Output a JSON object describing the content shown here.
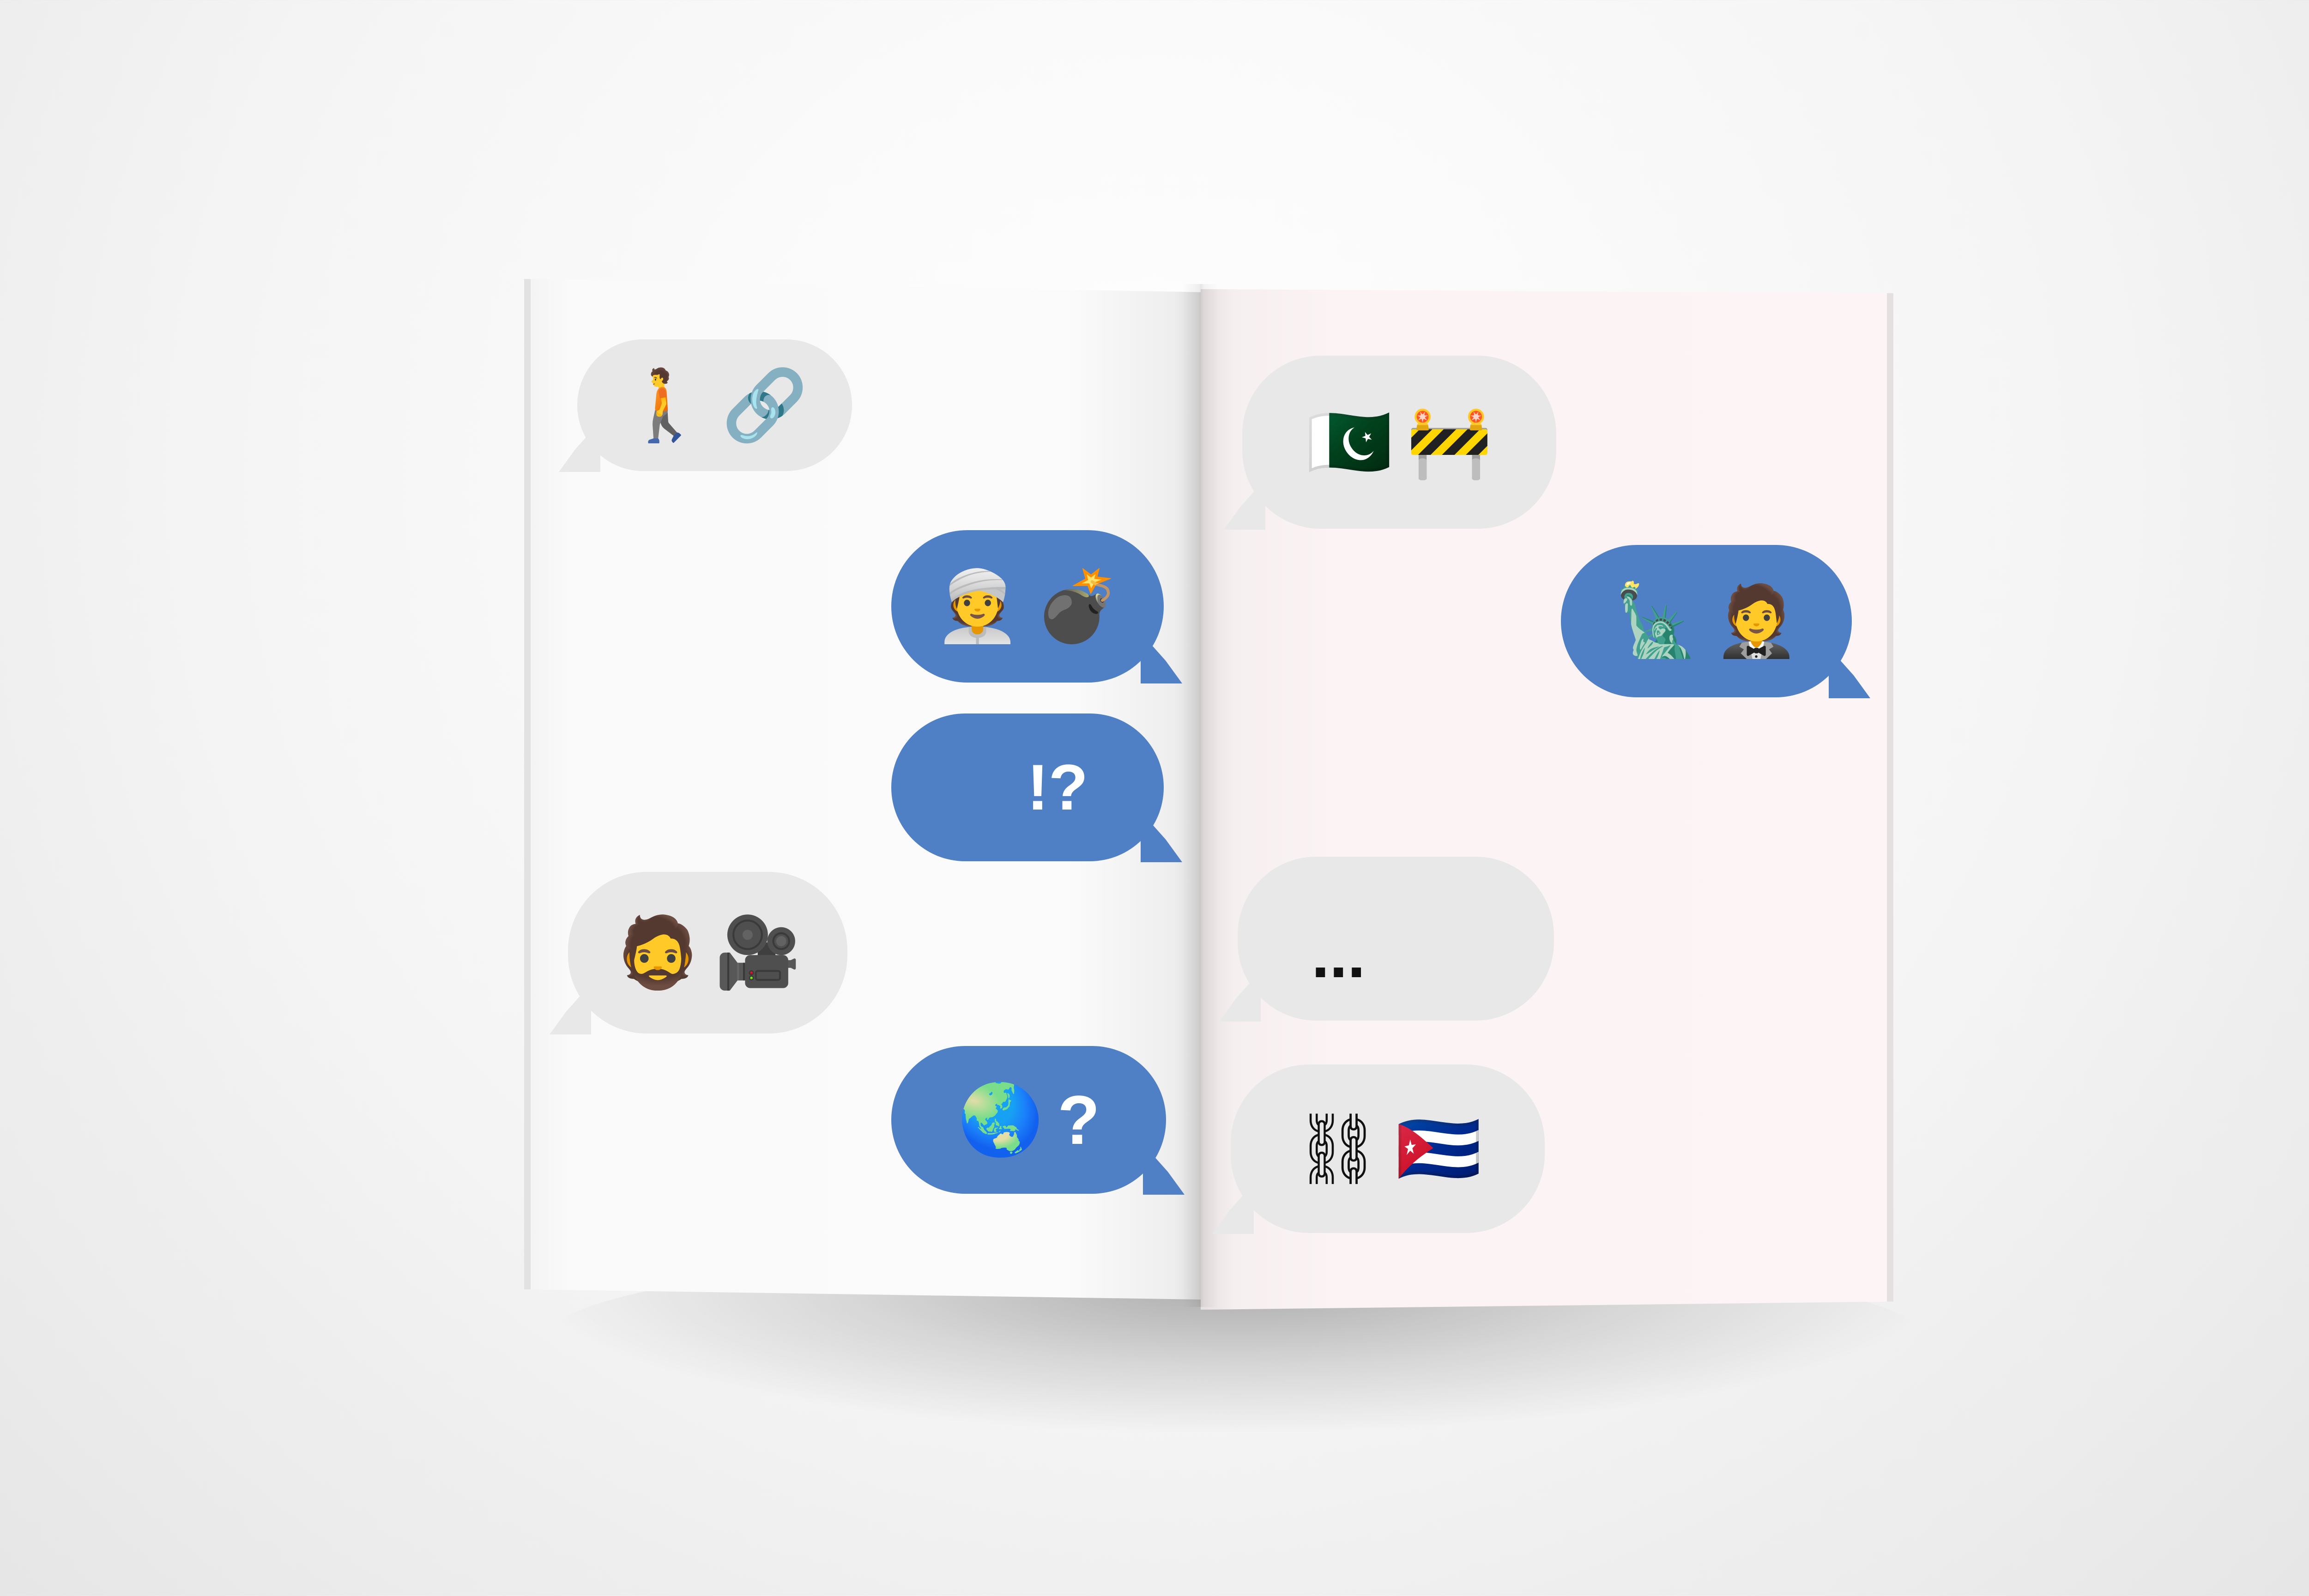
{
  "colors": {
    "incoming_bubble": "#e8e8e8",
    "outgoing_bubble": "#4f7fc4",
    "left_page": "#fbfbfb",
    "right_page": "#fdf5f5"
  },
  "left_page": {
    "messages": [
      {
        "side": "incoming",
        "parts": [
          "🚶",
          "🔗"
        ],
        "icons": [
          "person-walking-icon",
          "link-icon"
        ]
      },
      {
        "side": "outgoing",
        "parts": [
          "👳",
          "💣"
        ],
        "icons": [
          "man-with-turban-icon",
          "bomb-icon"
        ]
      },
      {
        "side": "outgoing",
        "parts": [
          "!?"
        ],
        "icons": []
      },
      {
        "side": "incoming",
        "parts": [
          "🧔",
          "🎥"
        ],
        "icons": [
          "bearded-man-icon",
          "movie-camera-icon"
        ]
      },
      {
        "side": "outgoing",
        "parts": [
          "🌏",
          "?"
        ],
        "icons": [
          "globe-asia-australia-icon"
        ]
      }
    ]
  },
  "right_page": {
    "messages": [
      {
        "side": "incoming",
        "parts": [
          "🇵🇰",
          "🚧"
        ],
        "icons": [
          "pakistan-flag-icon",
          "construction-barrier-icon"
        ]
      },
      {
        "side": "outgoing",
        "parts": [
          "🗽",
          "🤵"
        ],
        "icons": [
          "statue-of-liberty-icon",
          "man-in-suit-icon"
        ]
      },
      {
        "side": "incoming",
        "parts": [
          "..."
        ],
        "icons": []
      },
      {
        "side": "incoming",
        "parts": [
          "⛓",
          "🇨🇺"
        ],
        "icons": [
          "chains-icon",
          "cuba-flag-icon"
        ]
      }
    ]
  }
}
